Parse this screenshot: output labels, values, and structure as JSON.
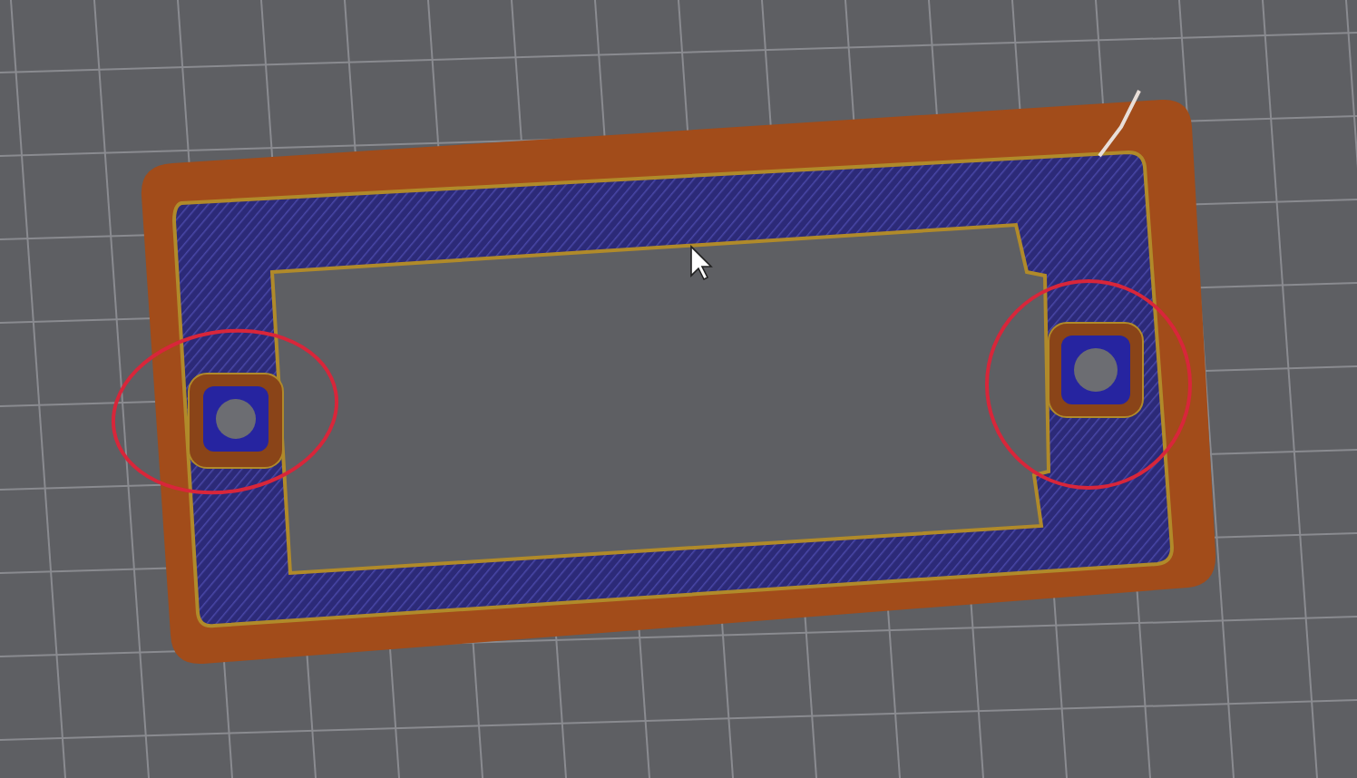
{
  "markup": [
    {
      "kind": "circle"
    },
    {
      "kind": "circle"
    }
  ]
}
